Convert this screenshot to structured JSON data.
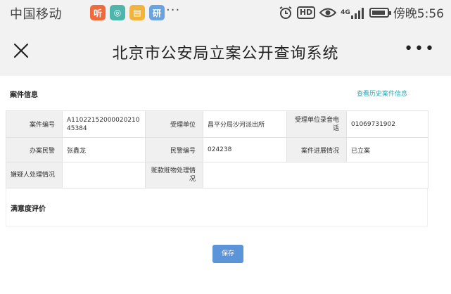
{
  "status_bar": {
    "carrier": "中国移动",
    "app_icons": [
      {
        "name": "listen-app-icon",
        "glyph": "听",
        "color": "#ef6a3c"
      },
      {
        "name": "camera-app-icon",
        "glyph": "◎",
        "color": "#4db6ac"
      },
      {
        "name": "notes-app-icon",
        "glyph": "▤",
        "color": "#f0b43c"
      },
      {
        "name": "browser-app-icon",
        "glyph": "研",
        "color": "#6aa3e0"
      }
    ],
    "more": "···",
    "network": "4G",
    "time": "傍晚5:56"
  },
  "header": {
    "title": "北京市公安局立案公开查询系统",
    "more": "•••"
  },
  "case_section": {
    "title": "案件信息",
    "history_link": "查看历史案件信息"
  },
  "case_table": {
    "rows": [
      [
        {
          "label": "案件编号",
          "value": "A1102215200002021045384"
        },
        {
          "label": "受理单位",
          "value": "昌平分局沙河派出所"
        },
        {
          "label": "受理单位录音电话",
          "value": "01069731902"
        }
      ],
      [
        {
          "label": "办案民警",
          "value": "张鑫龙"
        },
        {
          "label": "民警编号",
          "value": "024238"
        },
        {
          "label": "案件进展情况",
          "value": "已立案"
        }
      ],
      [
        {
          "label": "嫌疑人处理情况",
          "value": ""
        },
        {
          "label": "赃款赃物处理情况",
          "value": ""
        }
      ]
    ]
  },
  "satisfaction": {
    "title": "满意度评价"
  },
  "actions": {
    "save_label": "保存"
  }
}
